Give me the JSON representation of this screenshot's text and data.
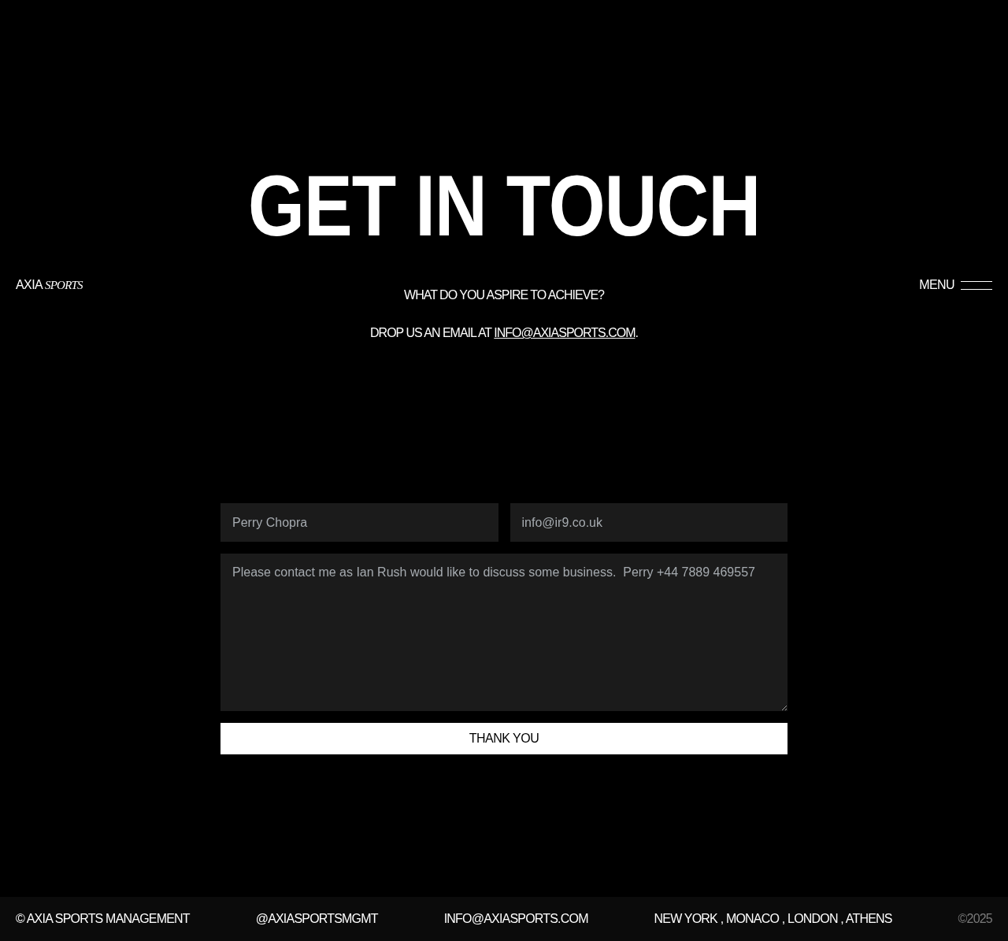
{
  "header": {
    "logo": {
      "text": "AXIA",
      "accent": "SPORTS"
    },
    "menu": {
      "label": "MENU"
    }
  },
  "hero": {
    "title": "GET IN TOUCH",
    "subtitle": "WHAT DO YOU ASPIRE TO ACHIEVE?",
    "email_line": {
      "before": "DROP US AN EMAIL AT",
      "link": "INFO@AXIASPORTS.COM",
      "after": "."
    }
  },
  "form": {
    "name": {
      "value": "Perry Chopra"
    },
    "email": {
      "value": "info@ir9.co.uk"
    },
    "message": {
      "value": "Please contact me as Ian Rush would like to discuss some business.  Perry +44 7889 469557"
    },
    "submit": {
      "label": "THANK YOU"
    }
  },
  "footer": {
    "copyright": "© AXIA SPORTS MANAGEMENT",
    "social": "@AXIASPORTSMGMT",
    "email": "INFO@AXIASPORTS.COM",
    "locations": "NEW YORK , MONACO , LONDON , ATHENS",
    "year": "©2025"
  }
}
